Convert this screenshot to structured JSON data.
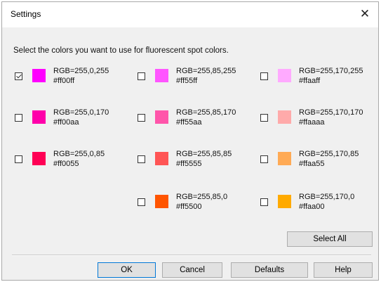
{
  "window": {
    "title": "Settings",
    "close_icon": "close-icon"
  },
  "instruction": "Select the colors you want to use for fluorescent spot colors.",
  "colors": [
    {
      "rgb": "RGB=255,0,255",
      "hex": "#ff00ff",
      "swatch": "#ff00ff",
      "checked": true
    },
    {
      "rgb": "RGB=255,85,255",
      "hex": "#ff55ff",
      "swatch": "#ff55ff",
      "checked": false
    },
    {
      "rgb": "RGB=255,170,255",
      "hex": "#ffaaff",
      "swatch": "#ffaaff",
      "checked": false
    },
    {
      "rgb": "RGB=255,0,170",
      "hex": "#ff00aa",
      "swatch": "#ff00aa",
      "checked": false
    },
    {
      "rgb": "RGB=255,85,170",
      "hex": "#ff55aa",
      "swatch": "#ff55aa",
      "checked": false
    },
    {
      "rgb": "RGB=255,170,170",
      "hex": "#ffaaaa",
      "swatch": "#ffaaaa",
      "checked": false
    },
    {
      "rgb": "RGB=255,0,85",
      "hex": "#ff0055",
      "swatch": "#ff0055",
      "checked": false
    },
    {
      "rgb": "RGB=255,85,85",
      "hex": "#ff5555",
      "swatch": "#ff5555",
      "checked": false
    },
    {
      "rgb": "RGB=255,170,85",
      "hex": "#ffaa55",
      "swatch": "#ffaa55",
      "checked": false
    },
    {
      "rgb": "RGB=255,85,0",
      "hex": "#ff5500",
      "swatch": "#ff5500",
      "checked": false
    },
    {
      "rgb": "RGB=255,170,0",
      "hex": "#ffaa00",
      "swatch": "#ffaa00",
      "checked": false
    }
  ],
  "buttons": {
    "select_all": "Select All",
    "ok": "OK",
    "cancel": "Cancel",
    "defaults": "Defaults",
    "help": "Help"
  }
}
